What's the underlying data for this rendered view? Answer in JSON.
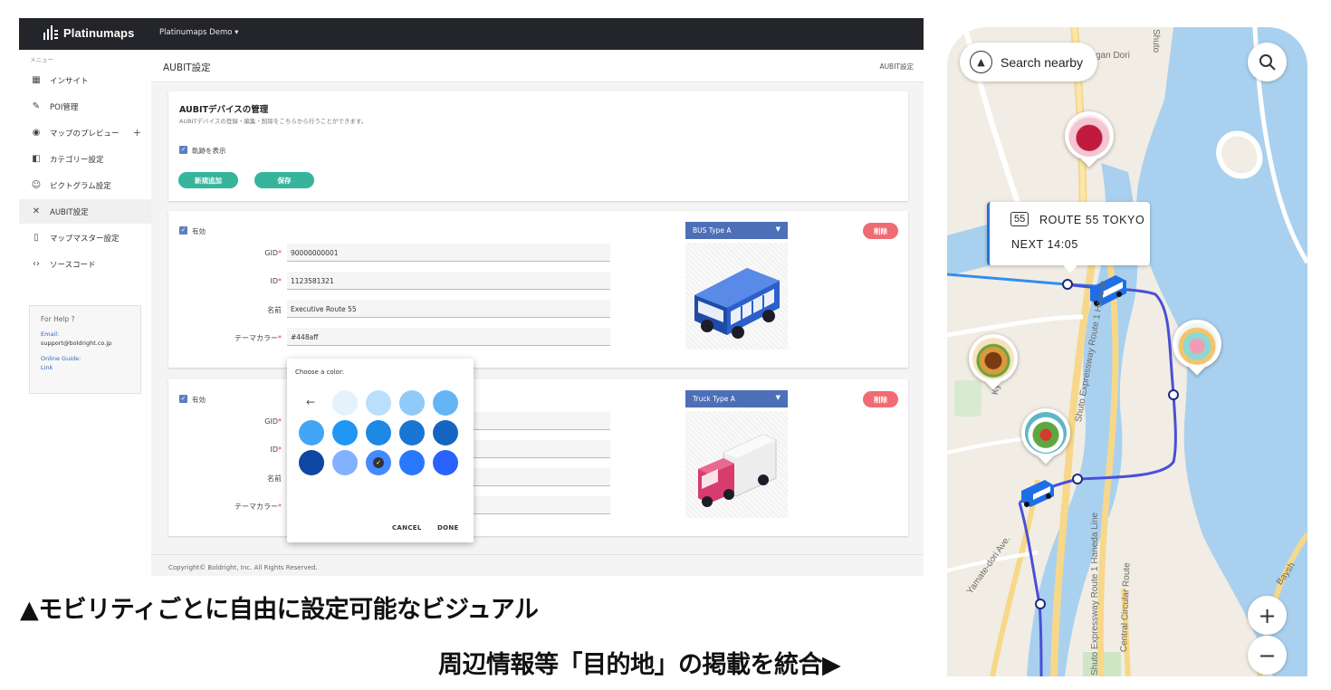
{
  "admin": {
    "brand": "Platinumaps",
    "project": "Platinumaps Demo ▾",
    "menu_label": "メニュー",
    "nav": [
      {
        "label": "インサイト"
      },
      {
        "label": "POI管理"
      },
      {
        "label": "マップのプレビュー"
      },
      {
        "label": "カテゴリー設定"
      },
      {
        "label": "ピクトグラム設定"
      },
      {
        "label": "AUBIT設定"
      },
      {
        "label": "マップマスター設定"
      },
      {
        "label": "ソースコード"
      }
    ],
    "help": {
      "title": "For Help ?",
      "email_label": "Email:",
      "email": "support@boldright.co.jp",
      "guide_label": "Online Guide:",
      "guide_link": "Link"
    },
    "page_title": "AUBIT設定",
    "breadcrumb": "AUBIT設定",
    "manage": {
      "title": "AUBITデバイスの管理",
      "subtitle": "AUBITデバイスの登録・編集・削除をこちらから行うことができます。",
      "show_track": "軌跡を表示",
      "add": "新規追加",
      "save": "保存"
    },
    "labels": {
      "enabled": "有効",
      "gid": "GID",
      "id": "ID",
      "name": "名前",
      "color": "テーマカラー",
      "req": "*",
      "delete": "削除"
    },
    "devices": [
      {
        "type": "BUS Type A",
        "gid": "90000000001",
        "id": "1123581321",
        "name": "Executive Route 55",
        "color": "#448aff"
      },
      {
        "type": "Truck Type A"
      }
    ],
    "picker": {
      "title": "Choose a color:",
      "cancel": "CANCEL",
      "done": "DONE",
      "swatches": [
        "#e3f2fd",
        "#bbdefb",
        "#90caf9",
        "#64b5f6",
        "#42a5f5",
        "#2196f3",
        "#1e88e5",
        "#1976d2",
        "#1565c0",
        "#0d47a1",
        "#82b1ff",
        "#448aff",
        "#2979ff",
        "#2962ff"
      ],
      "selected_index": 11
    },
    "footer": "Copyright© Boldright, Inc. All Rights Reserved."
  },
  "captions": {
    "left": "▲モビリティごとに自由に設定可能なビジュアル",
    "right": "周辺情報等「目的地」の掲載を統合▶"
  },
  "map": {
    "search_label": "Search nearby",
    "route_number": "55",
    "route_name": "ROUTE 55 TOKYO",
    "next": "NEXT  14:05",
    "zoom_in": "+",
    "zoom_out": "−",
    "labels": {
      "gan_dori": "gan Dori",
      "shuto_expressway": "Shuto Expressway Route 1 Haneda",
      "yamate_dori": "Yamate-dori Ave.",
      "haneda_line": "Shuto Expressway Route 1 Haneda Line",
      "central_circular": "Central Circular Route",
      "shuto_top": "Shuto",
      "bays": "Baysh",
      "ky": "Ky"
    },
    "colors": {
      "water": "#a9d1ef",
      "route": "#4a4fd8",
      "route_light": "#2f8ef0",
      "land": "#f1ede4"
    }
  }
}
